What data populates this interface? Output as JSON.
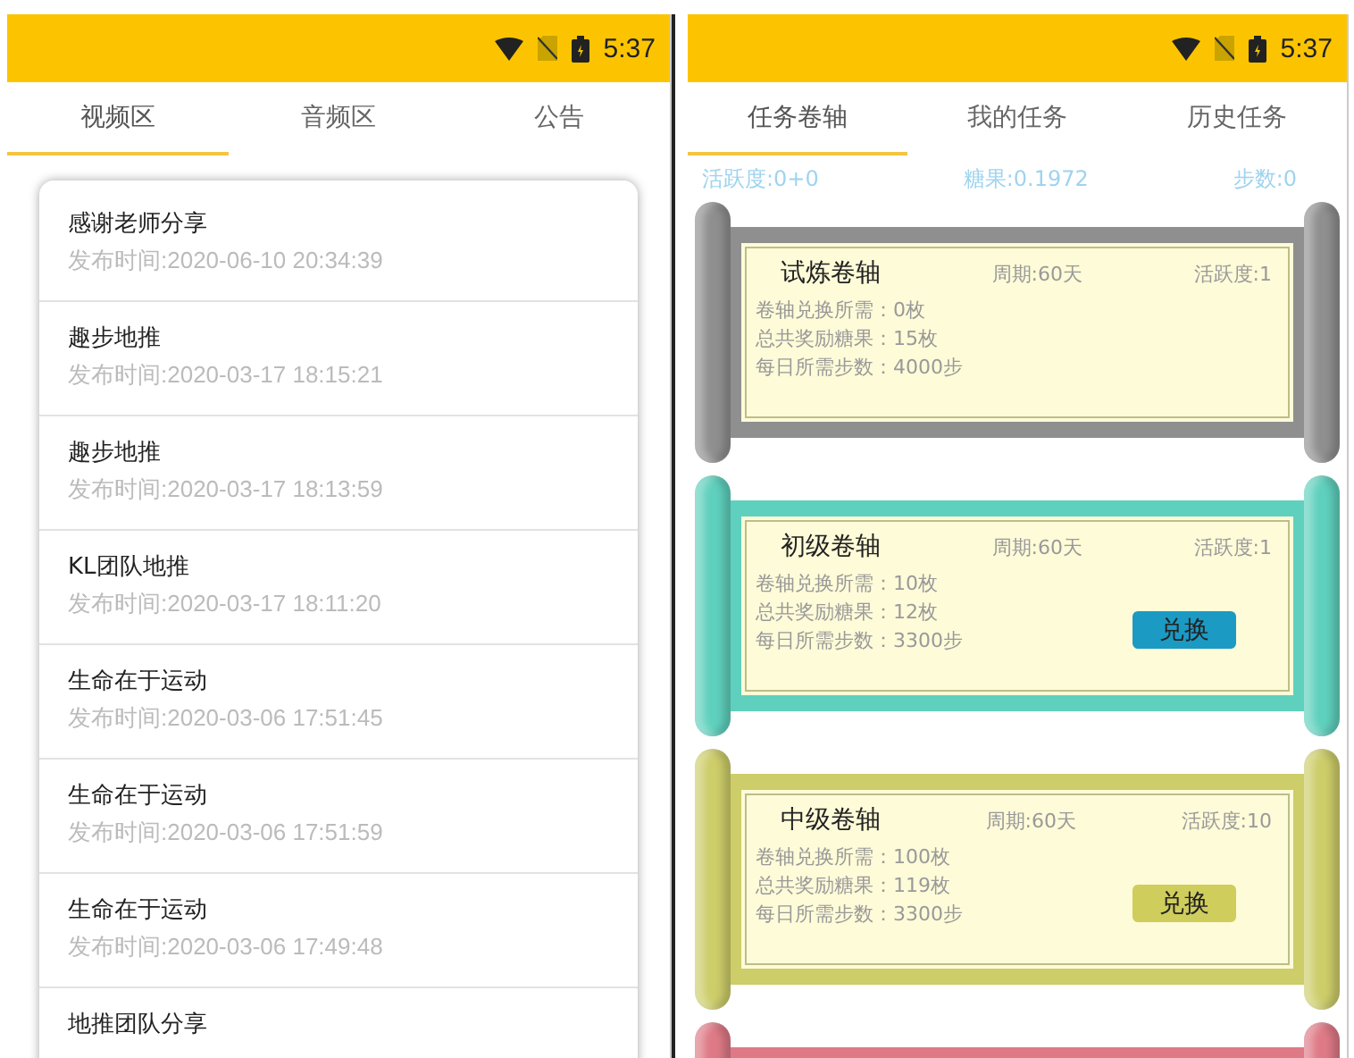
{
  "left_phone": {
    "status_bar": {
      "time": "5:37"
    },
    "tabs": [
      {
        "label": "视频区",
        "selected": true
      },
      {
        "label": "音频区",
        "selected": false
      },
      {
        "label": "公告",
        "selected": false
      }
    ],
    "posts": [
      {
        "title": "感谢老师分享",
        "time": "发布时间:2020-06-10 20:34:39"
      },
      {
        "title": "趣步地推",
        "time": "发布时间:2020-03-17 18:15:21"
      },
      {
        "title": "趣步地推",
        "time": "发布时间:2020-03-17 18:13:59"
      },
      {
        "title": "KL团队地推",
        "time": "发布时间:2020-03-17 18:11:20"
      },
      {
        "title": "生命在于运动",
        "time": "发布时间:2020-03-06 17:51:45"
      },
      {
        "title": "生命在于运动",
        "time": "发布时间:2020-03-06 17:51:59"
      },
      {
        "title": "生命在于运动",
        "time": "发布时间:2020-03-06 17:49:48"
      },
      {
        "title": "地推团队分享"
      }
    ]
  },
  "right_phone": {
    "status_bar": {
      "time": "5:37"
    },
    "tabs": [
      {
        "label": "任务卷轴",
        "selected": true
      },
      {
        "label": "我的任务",
        "selected": false
      },
      {
        "label": "历史任务",
        "selected": false
      }
    ],
    "stats": [
      "活跃度:0+0",
      "糖果:0.1972",
      "步数:0"
    ],
    "scrolls": [
      {
        "color": "#8f8f8f",
        "name": "试炼卷轴",
        "period": "周期:60天",
        "activity": "活跃度:1",
        "lines": [
          "卷轴兑换所需：0枚",
          "总共奖励糖果：15枚",
          "每日所需步数：4000步"
        ]
      },
      {
        "color": "#5fd0bd",
        "name": "初级卷轴",
        "period": "周期:60天",
        "activity": "活跃度:1",
        "lines": [
          "卷轴兑换所需：10枚",
          "总共奖励糖果：12枚",
          "每日所需步数：3300步"
        ],
        "button": {
          "label": "兑换",
          "color": "#1b9ac4"
        }
      },
      {
        "color": "#cdcd6a",
        "name": "中级卷轴",
        "period": "周期:60天",
        "activity": "活跃度:10",
        "lines": [
          "卷轴兑换所需：100枚",
          "总共奖励糖果：119枚",
          "每日所需步数：3300步"
        ],
        "button": {
          "label": "兑换",
          "color": "#cfcd5c"
        }
      },
      {
        "color": "#de7a86"
      }
    ]
  }
}
